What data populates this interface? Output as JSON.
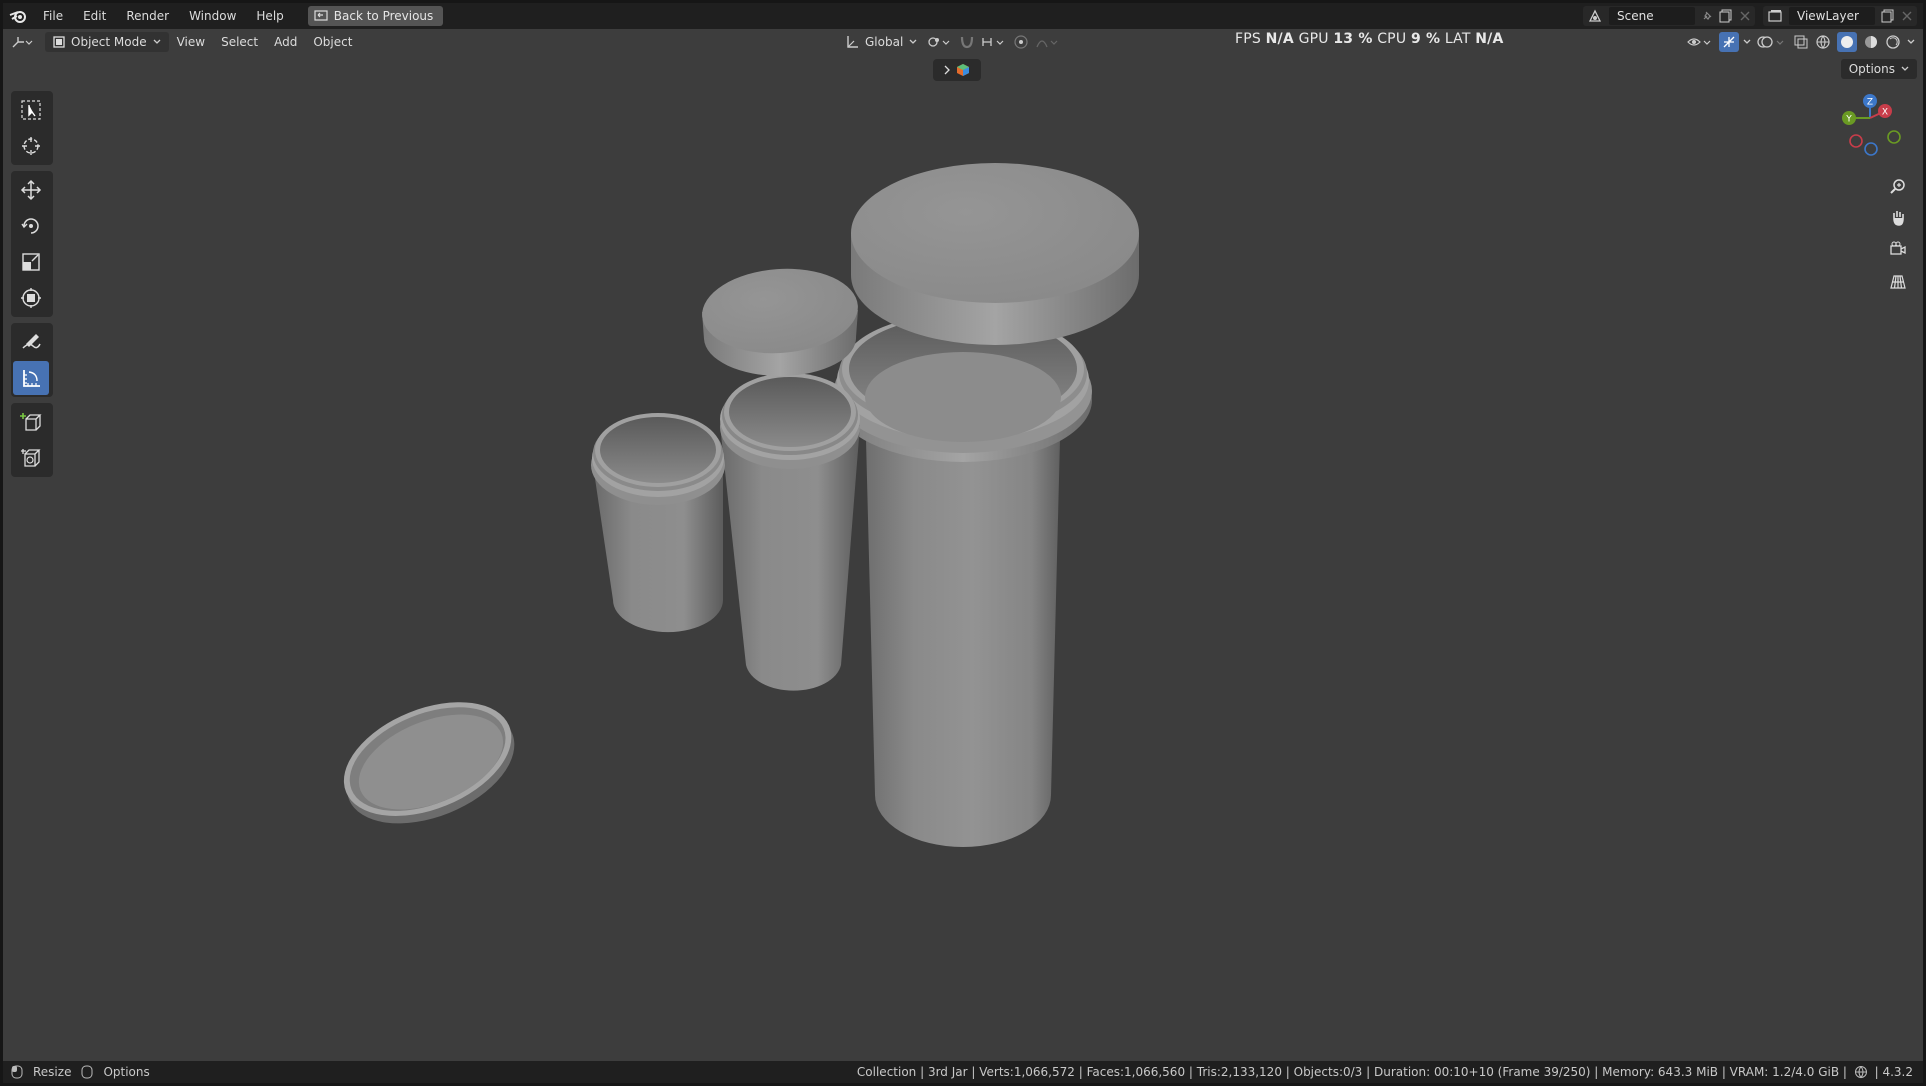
{
  "menubar": {
    "items": [
      "File",
      "Edit",
      "Render",
      "Window",
      "Help"
    ],
    "back_button": "Back to Previous",
    "scene_name": "Scene",
    "view_layer": "ViewLayer"
  },
  "viewport_header": {
    "mode": "Object Mode",
    "menus": [
      "View",
      "Select",
      "Add",
      "Object"
    ],
    "transform_orientation": "Global"
  },
  "stats": {
    "fps_label": "FPS",
    "fps_value": "N/A",
    "gpu_label": "GPU",
    "gpu_value": "13 %",
    "cpu_label": "CPU",
    "cpu_value": "9 %",
    "lat_label": "LAT",
    "lat_value": "N/A"
  },
  "viewport": {
    "options_label": "Options"
  },
  "statusbar": {
    "left_items": [
      "Resize",
      "Options"
    ],
    "info": "Collection | 3rd Jar | Verts:1,066,572 | Faces:1,066,560 | Tris:2,133,120 | Objects:0/3 | Duration: 00:10+10 (Frame 39/250) | Memory: 643.3 MiB | VRAM: 1.2/4.0 GiB |",
    "version": "4.3.2"
  },
  "colors": {
    "accent": "#4772b3",
    "viewport_bg": "#3d3d3d",
    "header_bg": "#1f1f1f",
    "axis_x": "#c83d4a",
    "axis_y": "#6a9a23",
    "axis_z": "#3c77c9"
  },
  "icons": {
    "toolbar": [
      "select-box-icon",
      "cursor-icon",
      "move-icon",
      "rotate-icon",
      "scale-icon",
      "transform-icon",
      "annotate-icon",
      "measure-icon",
      "add-cube-icon",
      "add-primitive-icon"
    ],
    "nav": [
      "zoom-icon",
      "pan-hand-icon",
      "camera-icon",
      "perspective-grid-icon"
    ]
  }
}
